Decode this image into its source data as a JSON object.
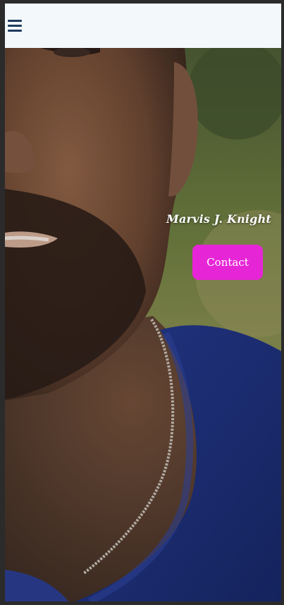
{
  "nav": {
    "menu_icon": "hamburger-icon"
  },
  "hero": {
    "name": "Marvis J. Knight",
    "contact_label": "Contact"
  },
  "colors": {
    "topbar_bg": "#f3f9fa",
    "menu_icon": "#1f3a5f",
    "contact_button": "#e626d6",
    "shirt": "#1c2f78",
    "skin": "#6b4a36"
  }
}
